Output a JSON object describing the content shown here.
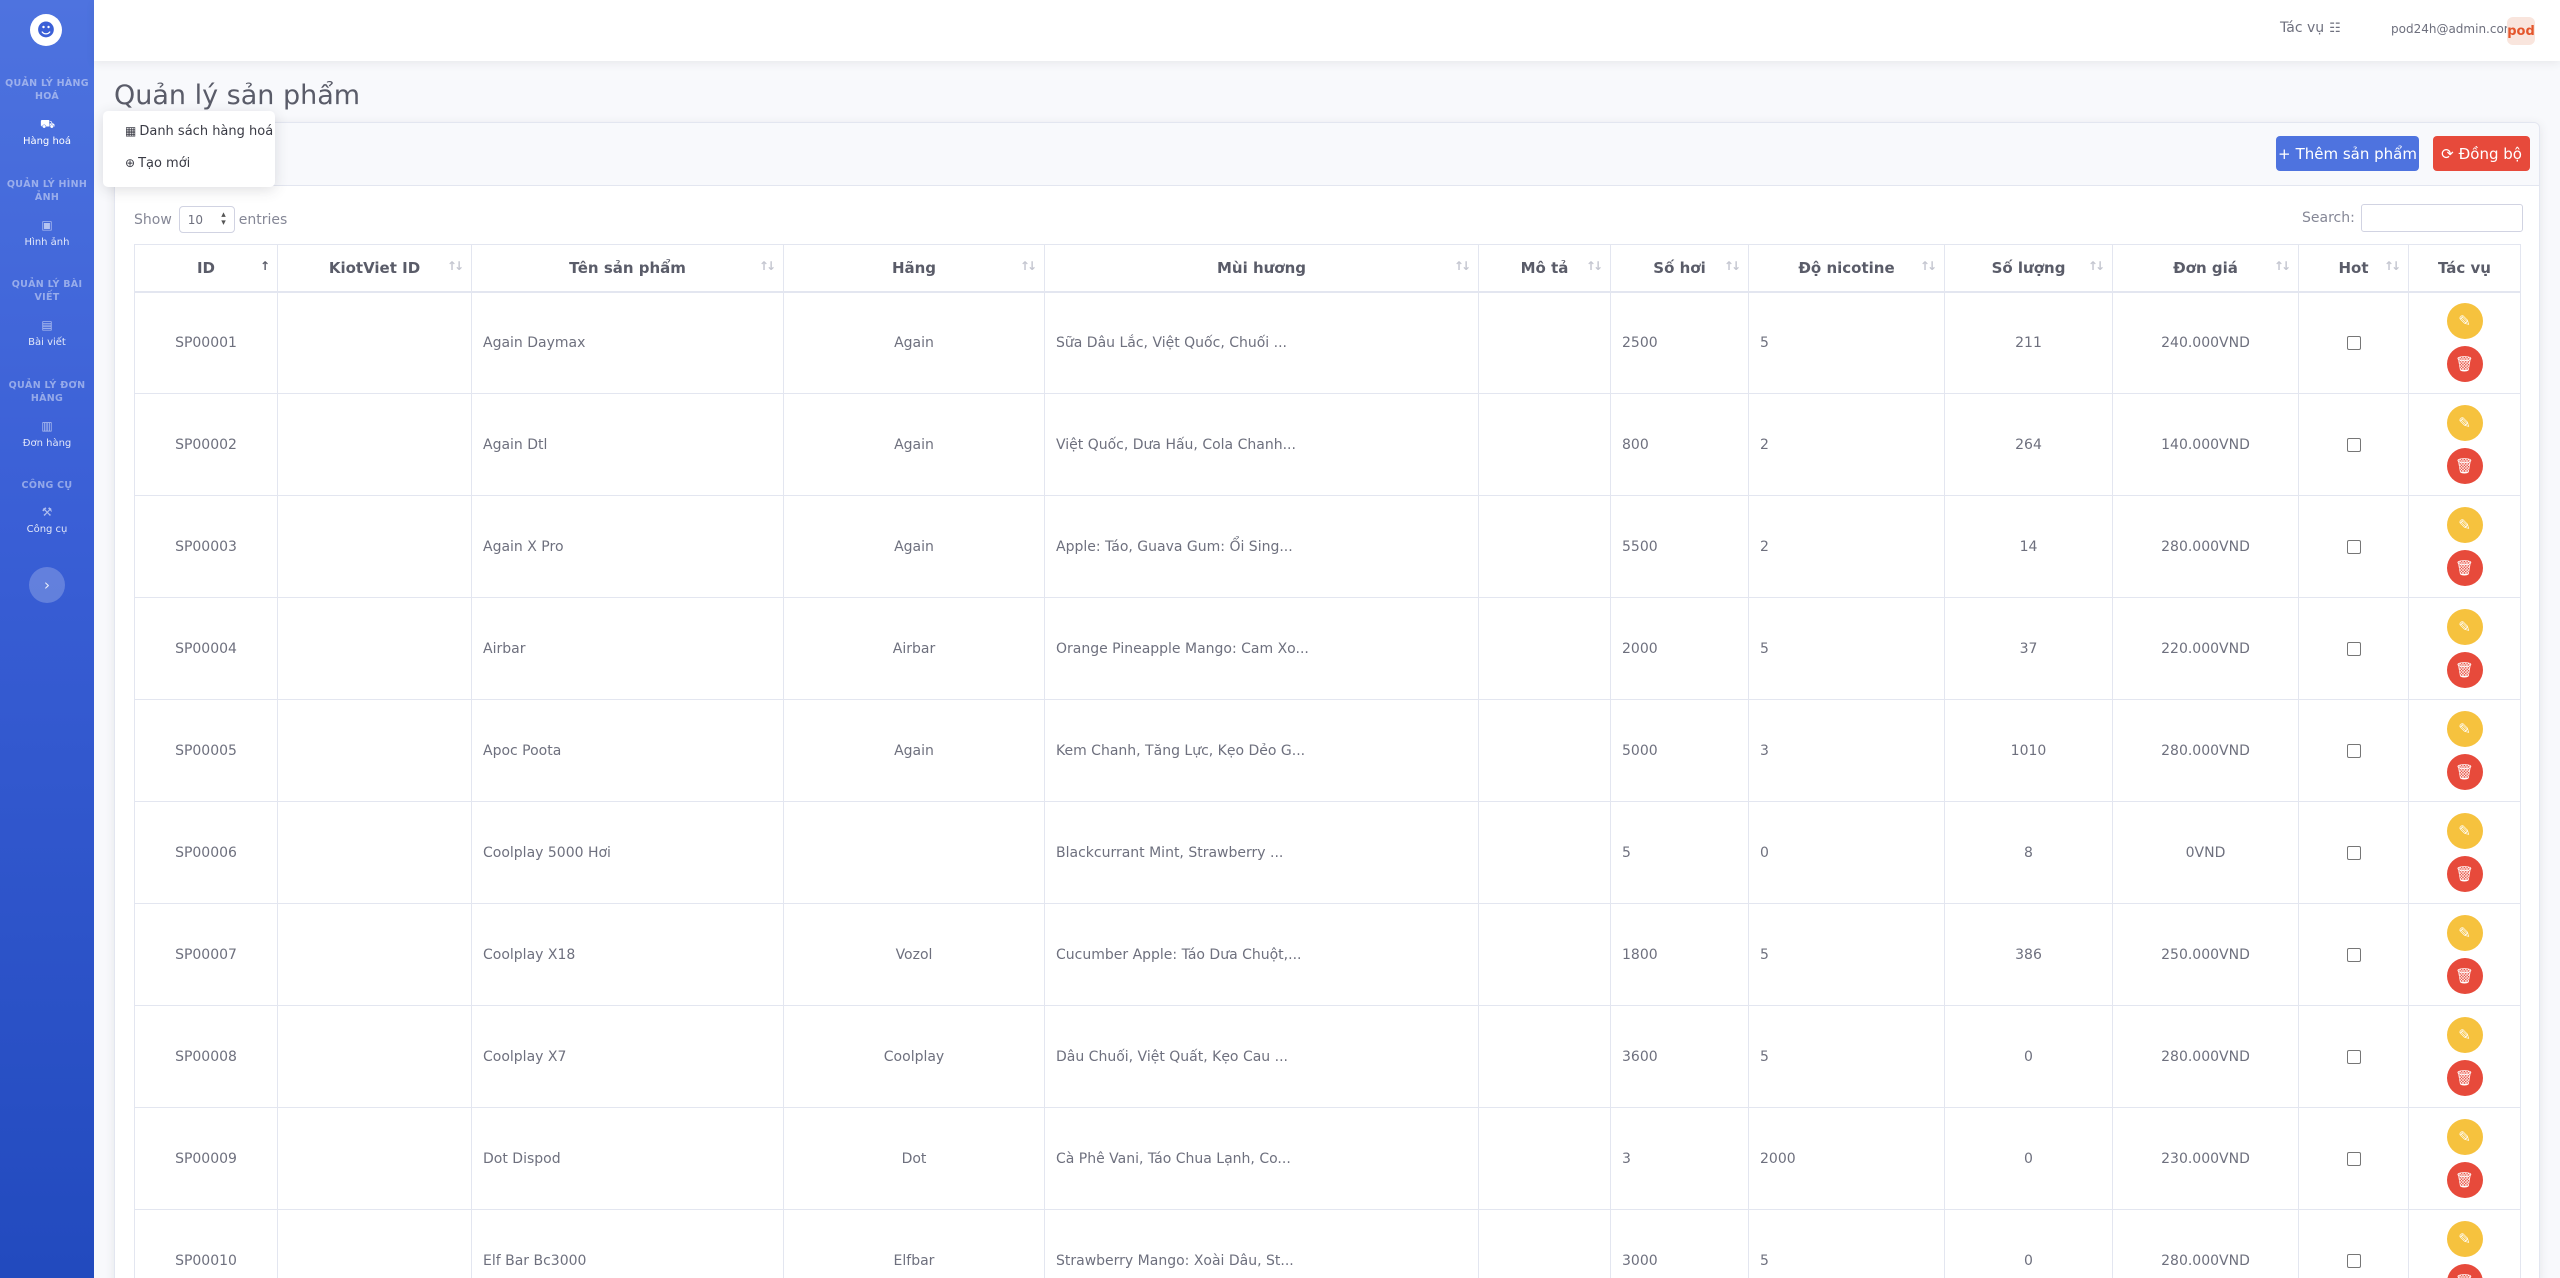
{
  "sidebar": {
    "groups": [
      {
        "heading": "QUẢN LÝ HÀNG HOÁ",
        "item": "Hàng hoá",
        "icon": "box-icon",
        "glyph": "⛟"
      },
      {
        "heading": "QUẢN LÝ HÌNH ẢNH",
        "item": "Hình ảnh",
        "icon": "image-icon",
        "glyph": "▣"
      },
      {
        "heading": "QUẢN LÝ BÀI VIẾT",
        "item": "Bài viết",
        "icon": "newspaper-icon",
        "glyph": "▤"
      },
      {
        "heading": "QUẢN LÝ ĐƠN HÀNG",
        "item": "Đơn hàng",
        "icon": "store-icon",
        "glyph": "▥"
      },
      {
        "heading": "CÔNG CỤ",
        "item": "Công cụ",
        "icon": "tools-icon",
        "glyph": "⚒"
      }
    ],
    "toggle_glyph": "›"
  },
  "topbar": {
    "tasks_label": "Tác vụ",
    "tasks_icon": "☷",
    "user_email": "pod24h@admin.com",
    "avatar_text": "pod"
  },
  "page_title": "Quản lý sản phẩm",
  "dropdown": {
    "items": [
      {
        "label": "Danh sách hàng hoá",
        "icon": "table-icon",
        "glyph": "▦"
      },
      {
        "label": "Tạo mới",
        "icon": "plus-circle-icon",
        "glyph": "⊕"
      }
    ]
  },
  "actions": {
    "add_label": "Thêm sản phẩm",
    "add_glyph": "+",
    "sync_label": "Đồng bộ",
    "sync_glyph": "⟳"
  },
  "table_controls": {
    "show_label": "Show",
    "entries_value": "10",
    "entries_label": "entries",
    "search_label": "Search:"
  },
  "colors": {
    "primary": "#4e73df",
    "danger": "#e74a3b",
    "warning": "#f6c23e"
  },
  "table": {
    "columns": [
      "ID",
      "KiotViet ID",
      "Tên sản phẩm",
      "Hãng",
      "Mùi hương",
      "Mô tả",
      "Số hơi",
      "Độ nicotine",
      "Số lượng",
      "Đơn giá",
      "Hot",
      "Tác vụ"
    ],
    "rows": [
      {
        "id": "SP00001",
        "kiotviet": "",
        "name": "Again Daymax",
        "brand": "Again",
        "flavor": "Sữa Dâu Lắc, Việt Quốc, Chuối ...",
        "desc": "",
        "puffs": "2500",
        "nicotine": "5",
        "qty": "211",
        "price": "240.000VND",
        "hot": false
      },
      {
        "id": "SP00002",
        "kiotviet": "",
        "name": "Again Dtl",
        "brand": "Again",
        "flavor": "Việt Quốc, Dưa Hấu, Cola Chanh...",
        "desc": "",
        "puffs": "800",
        "nicotine": "2",
        "qty": "264",
        "price": "140.000VND",
        "hot": false
      },
      {
        "id": "SP00003",
        "kiotviet": "",
        "name": "Again X Pro",
        "brand": "Again",
        "flavor": "Apple: Táo, Guava Gum: Ổi Sing...",
        "desc": "",
        "puffs": "5500",
        "nicotine": "2",
        "qty": "14",
        "price": "280.000VND",
        "hot": false
      },
      {
        "id": "SP00004",
        "kiotviet": "",
        "name": "Airbar",
        "brand": "Airbar",
        "flavor": "Orange Pineapple Mango: Cam Xo...",
        "desc": "",
        "puffs": "2000",
        "nicotine": "5",
        "qty": "37",
        "price": "220.000VND",
        "hot": false
      },
      {
        "id": "SP00005",
        "kiotviet": "",
        "name": "Apoc Poota",
        "brand": "Again",
        "flavor": "Kem Chanh, Tăng Lực, Kẹo Dẻo G...",
        "desc": "",
        "puffs": "5000",
        "nicotine": "3",
        "qty": "1010",
        "price": "280.000VND",
        "hot": false
      },
      {
        "id": "SP00006",
        "kiotviet": "",
        "name": "Coolplay 5000 Hơi",
        "brand": "",
        "flavor": "Blackcurrant Mint, Strawberry ...",
        "desc": "",
        "puffs": "5",
        "nicotine": "0",
        "qty": "8",
        "price": "0VND",
        "hot": false
      },
      {
        "id": "SP00007",
        "kiotviet": "",
        "name": "Coolplay X18",
        "brand": "Vozol",
        "flavor": "Cucumber Apple: Táo Dưa Chuột,...",
        "desc": "",
        "puffs": "1800",
        "nicotine": "5",
        "qty": "386",
        "price": "250.000VND",
        "hot": false
      },
      {
        "id": "SP00008",
        "kiotviet": "",
        "name": "Coolplay X7",
        "brand": "Coolplay",
        "flavor": "Dâu Chuối, Việt Quất, Kẹo Cau ...",
        "desc": "",
        "puffs": "3600",
        "nicotine": "5",
        "qty": "0",
        "price": "280.000VND",
        "hot": false
      },
      {
        "id": "SP00009",
        "kiotviet": "",
        "name": "Dot Dispod",
        "brand": "Dot",
        "flavor": "Cà Phê Vani, Táo Chua Lạnh, Co...",
        "desc": "",
        "puffs": "3",
        "nicotine": "2000",
        "qty": "0",
        "price": "230.000VND",
        "hot": false
      },
      {
        "id": "SP00010",
        "kiotviet": "",
        "name": "Elf Bar Bc3000",
        "brand": "Elfbar",
        "flavor": "Strawberry Mango: Xoài Dâu, St...",
        "desc": "",
        "puffs": "3000",
        "nicotine": "5",
        "qty": "0",
        "price": "280.000VND",
        "hot": false
      }
    ],
    "edit_glyph": "✎",
    "delete_glyph": "🗑"
  }
}
